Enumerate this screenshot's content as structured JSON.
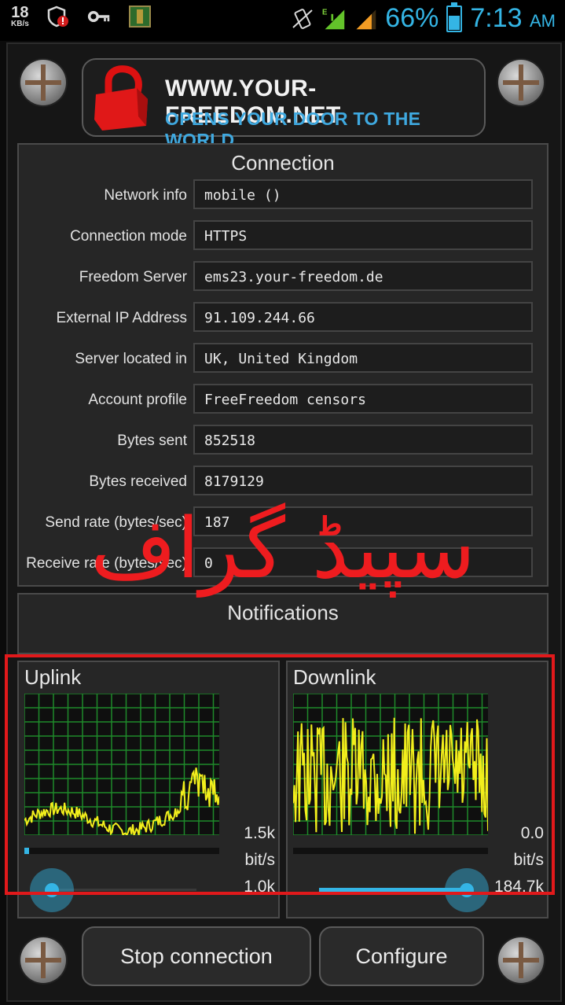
{
  "status_bar": {
    "net_speed": "18",
    "net_unit": "KB/s",
    "battery": "66%",
    "battery_level": 0.66,
    "time": "7:13",
    "ampm": "AM",
    "icons": [
      "shield-alert-icon",
      "key-icon",
      "app-notification-icon",
      "vibrate-icon",
      "signal-edge-icon",
      "signal-icon",
      "battery-icon"
    ]
  },
  "banner": {
    "title": "WWW.YOUR-FREEDOM.NET",
    "subtitle": "OPENS YOUR DOOR TO THE WORLD",
    "logo_icon": "red-padlock-icon"
  },
  "connection": {
    "title": "Connection",
    "rows": [
      {
        "label": "Network info",
        "value": "mobile ()"
      },
      {
        "label": "Connection mode",
        "value": "HTTPS"
      },
      {
        "label": "Freedom Server",
        "value": "ems23.your-freedom.de"
      },
      {
        "label": "External IP Address",
        "value": "91.109.244.66"
      },
      {
        "label": "Server located in",
        "value": "UK, United Kingdom"
      },
      {
        "label": "Account profile",
        "value": "FreeFreedom censors"
      },
      {
        "label": "Bytes sent",
        "value": "852518"
      },
      {
        "label": "Bytes received",
        "value": "8179129"
      },
      {
        "label": "Send rate (bytes/sec)",
        "value": "187"
      },
      {
        "label": "Receive rate (bytes/sec)",
        "value": "0"
      }
    ]
  },
  "notifications": {
    "title": "Notifications"
  },
  "overlay_text": "سپیڈ گراف",
  "uplink": {
    "title": "Uplink",
    "max_label": "1.5k",
    "unit": "bit/s",
    "min_label": "1.0k",
    "progress": 0.02,
    "slider": 0.0
  },
  "downlink": {
    "title": "Downlink",
    "max_label": "0.0",
    "unit": "bit/s",
    "min_label": "184.7k",
    "progress": 0.0,
    "slider": 1.0
  },
  "buttons": {
    "stop": "Stop connection",
    "configure": "Configure"
  },
  "colors": {
    "accent": "#34b5e5",
    "graph_line": "#f2ee1c",
    "grid": "#1f8a2a",
    "highlight": "#e1191b"
  }
}
